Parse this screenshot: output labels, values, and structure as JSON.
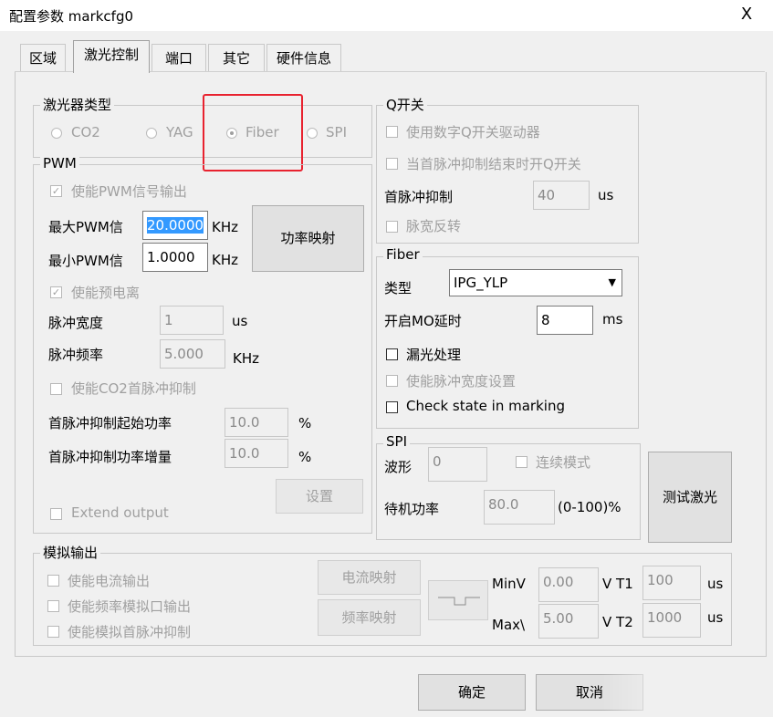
{
  "window": {
    "title": "配置参数 markcfg0",
    "close": "X"
  },
  "tabs": [
    "区域",
    "激光控制",
    "端口",
    "其它",
    "硬件信息"
  ],
  "laser_type": {
    "label": "激光器类型",
    "options": [
      "CO2",
      "YAG",
      "Fiber",
      "SPI"
    ],
    "selected": "Fiber"
  },
  "pwm": {
    "label": "PWM",
    "enable_pwm_label": "使能PWM信号输出",
    "max_pwm_label": "最大PWM信",
    "max_pwm_value": "20.0000",
    "max_pwm_unit": "KHz",
    "min_pwm_label": "最小PWM信",
    "min_pwm_value": "1.0000",
    "min_pwm_unit": "KHz",
    "power_map_button": "功率映射",
    "enable_preion_label": "使能预电离",
    "pulse_width_label": "脉冲宽度",
    "pulse_width_value": "1",
    "pulse_width_unit": "us",
    "pulse_freq_label": "脉冲频率",
    "pulse_freq_value": "5.000",
    "pulse_freq_unit": "KHz",
    "enable_co2_first_label": "使能CO2首脉冲抑制",
    "first_start_power_label": "首脉冲抑制起始功率",
    "first_start_power_value": "10.0",
    "first_start_power_unit": "%",
    "first_power_inc_label": "首脉冲抑制功率增量",
    "first_power_inc_value": "10.0",
    "first_power_inc_unit": "%",
    "settings_button": "设置",
    "extend_output_label": "Extend output"
  },
  "qswitch": {
    "label": "Q开关",
    "use_digital_label": "使用数字Q开关驱动器",
    "open_q_label": "当首脉冲抑制结束时开Q开关",
    "first_suppress_label": "首脉冲抑制",
    "first_suppress_value": "40",
    "first_suppress_unit": "us",
    "pulse_invert_label": "脉宽反转"
  },
  "fiber": {
    "label": "Fiber",
    "type_label": "类型",
    "type_value": "IPG_YLP",
    "mo_delay_label": "开启MO延时",
    "mo_delay_value": "8",
    "mo_delay_unit": "ms",
    "leak_label": "漏光处理",
    "enable_width_label": "使能脉冲宽度设置",
    "check_state_label": "Check state in marking"
  },
  "spi": {
    "label": "SPI",
    "wave_label": "波形",
    "wave_value": "0",
    "continuous_label": "连续模式",
    "standby_label": "待机功率",
    "standby_value": "80.0",
    "standby_unit": "(0-100)%"
  },
  "test_laser_button": "测试激光",
  "analog": {
    "label": "模拟输出",
    "enable_current_label": "使能电流输出",
    "enable_freq_label": "使能频率模拟口输出",
    "enable_first_label": "使能模拟首脉冲抑制",
    "current_map_button": "电流映射",
    "freq_map_button": "频率映射",
    "minv_label": "MinV",
    "minv_value": "0.00",
    "maxv_label": "Max\\",
    "maxv_value": "5.00",
    "vt1_label": "V T1",
    "t1_value": "100",
    "vt2_label": "V T2",
    "t2_value": "1000",
    "t_unit": "us"
  },
  "footer": {
    "ok": "确定",
    "cancel": "取消"
  }
}
